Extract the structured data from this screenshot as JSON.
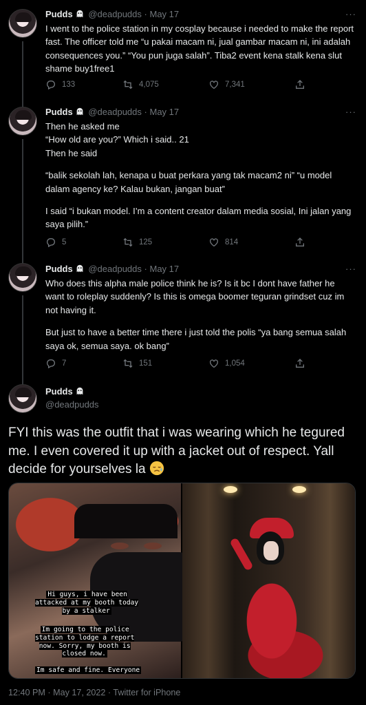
{
  "colors": {
    "background": "#000000",
    "text": "#e7e9ea",
    "muted": "#71767b",
    "divider": "#2f3336"
  },
  "tweets": [
    {
      "name": "Pudds",
      "handle": "@deadpudds",
      "sep": "·",
      "date": "May 17",
      "more": "···",
      "lines": [
        "I went to the police station in my cosplay because i needed to make the report fast. The officer told me “u pakai macam ni, jual gambar macam ni, ini adalah consequences you.” “You pun juga salah”. Tiba2 event kena stalk kena slut shame buy1free1"
      ],
      "replies": "133",
      "retweets": "4,075",
      "likes": "7,341"
    },
    {
      "name": "Pudds",
      "handle": "@deadpudds",
      "sep": "·",
      "date": "May 17",
      "more": "···",
      "lines": [
        "Then he asked me",
        "“How old are you?” Which i said.. 21",
        "Then he said",
        "“balik sekolah lah, kenapa u buat perkara yang tak macam2 ni” “u model dalam agency ke? Kalau bukan, jangan buat”",
        "I said “i bukan model. I’m a content creator dalam media sosial, Ini jalan yang saya pilih.”"
      ],
      "replies": "5",
      "retweets": "125",
      "likes": "814"
    },
    {
      "name": "Pudds",
      "handle": "@deadpudds",
      "sep": "·",
      "date": "May 17",
      "more": "···",
      "lines": [
        "Who does this alpha male police think he is? Is it bc I dont have father he want to roleplay suddenly? Is this is omega boomer teguran grindset cuz im not having it.",
        "But just to have a better time there i just told the polis “ya bang semua salah saya ok, semua saya. ok bang”"
      ],
      "replies": "7",
      "retweets": "151",
      "likes": "1,054"
    }
  ],
  "main": {
    "name": "Pudds",
    "handle": "@deadpudds",
    "text": "FYI this was the outfit that i was wearing which he tegured me. I even covered it up with a jacket out of respect. Yall decide for yourselves la",
    "story": {
      "p1": "Hi guys, i have been\nattacked at my booth today\nby a stalker",
      "p2": "Im going to the police\nstation to lodge a report\nnow. Sorry, my booth is\nclosed now.",
      "p3": "Im safe and fine. Everyone"
    },
    "timestamp": "12:40 PM · May 17, 2022 · Twitter for iPhone"
  },
  "icons": [
    "reply-icon",
    "retweet-icon",
    "like-icon",
    "share-icon",
    "ghost-emoji",
    "sad-face-emoji"
  ]
}
